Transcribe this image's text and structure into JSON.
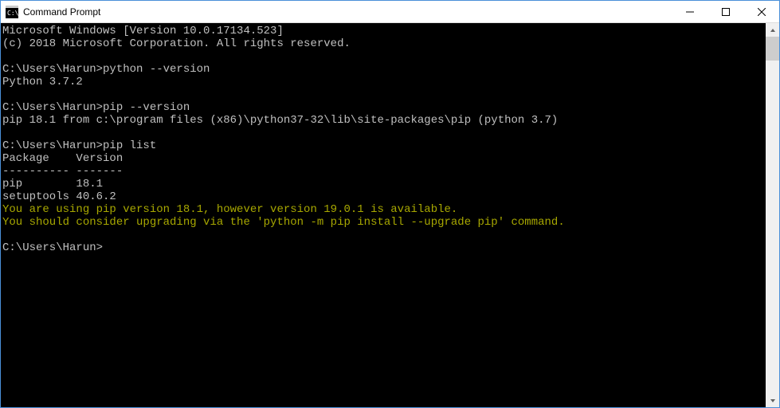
{
  "window": {
    "title": "Command Prompt"
  },
  "console": {
    "lines": [
      {
        "text": "Microsoft Windows [Version 10.0.17134.523]",
        "cls": ""
      },
      {
        "text": "(c) 2018 Microsoft Corporation. All rights reserved.",
        "cls": ""
      },
      {
        "text": "",
        "cls": ""
      },
      {
        "text": "C:\\Users\\Harun>python --version",
        "cls": ""
      },
      {
        "text": "Python 3.7.2",
        "cls": ""
      },
      {
        "text": "",
        "cls": ""
      },
      {
        "text": "C:\\Users\\Harun>pip --version",
        "cls": ""
      },
      {
        "text": "pip 18.1 from c:\\program files (x86)\\python37-32\\lib\\site-packages\\pip (python 3.7)",
        "cls": ""
      },
      {
        "text": "",
        "cls": ""
      },
      {
        "text": "C:\\Users\\Harun>pip list",
        "cls": ""
      },
      {
        "text": "Package    Version",
        "cls": ""
      },
      {
        "text": "---------- -------",
        "cls": ""
      },
      {
        "text": "pip        18.1",
        "cls": ""
      },
      {
        "text": "setuptools 40.6.2",
        "cls": ""
      },
      {
        "text": "You are using pip version 18.1, however version 19.0.1 is available.",
        "cls": "warn"
      },
      {
        "text": "You should consider upgrading via the 'python -m pip install --upgrade pip' command.",
        "cls": "warn"
      },
      {
        "text": "",
        "cls": ""
      },
      {
        "text": "C:\\Users\\Harun>",
        "cls": ""
      }
    ]
  }
}
